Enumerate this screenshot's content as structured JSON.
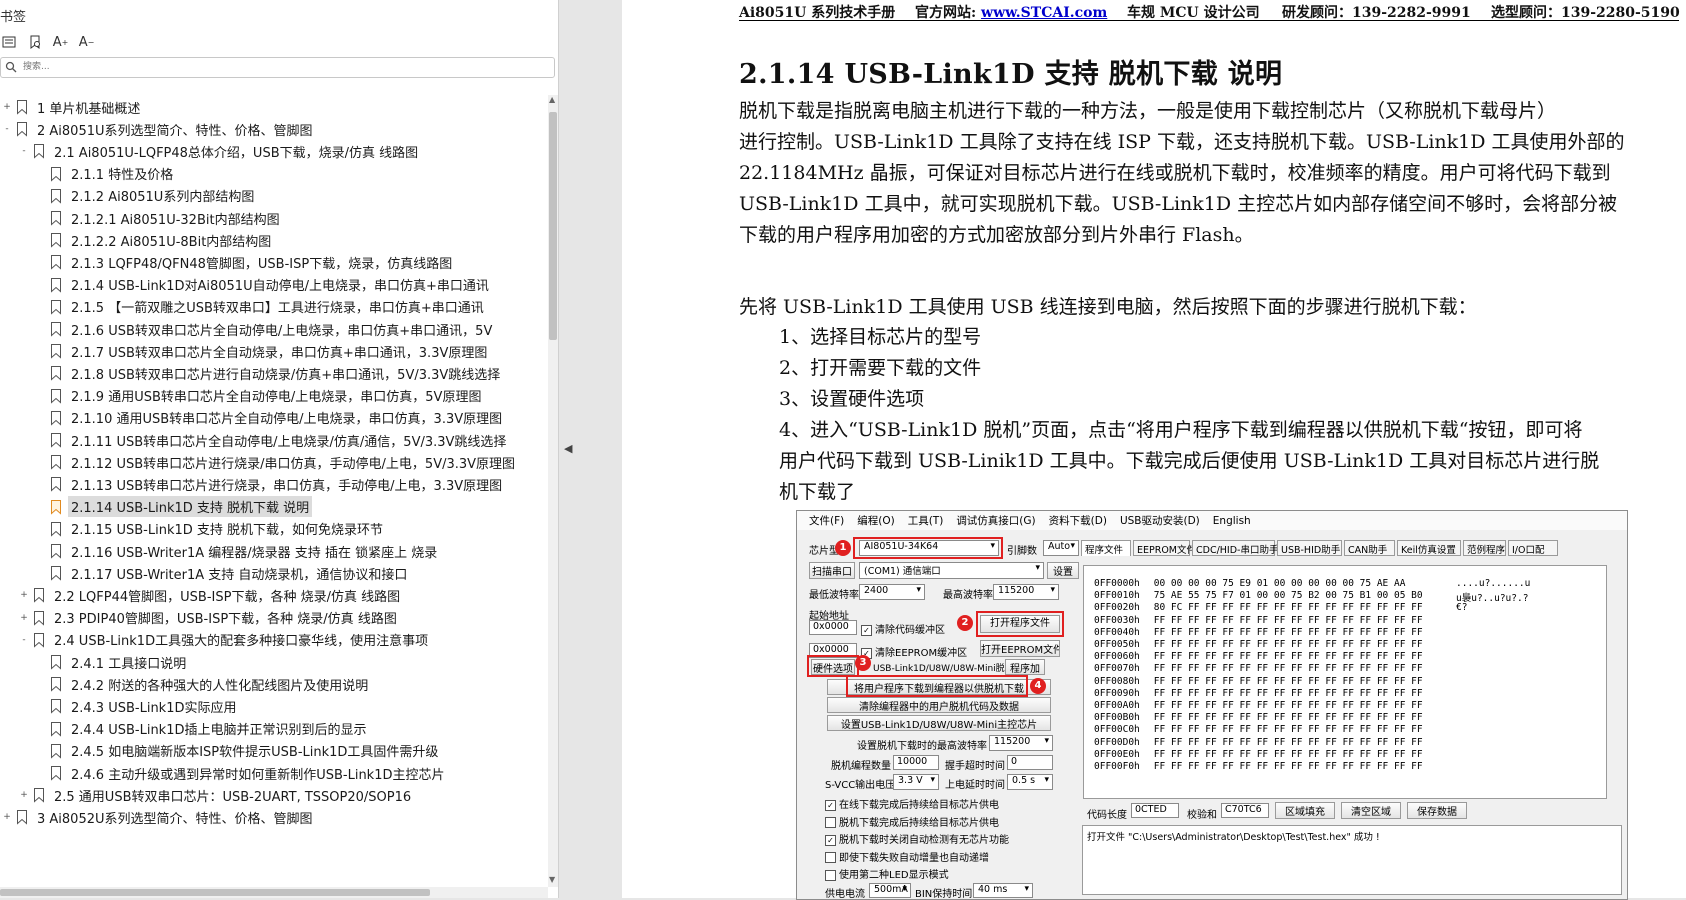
{
  "sidebar": {
    "title": "书签",
    "search_placeholder": "搜索...",
    "tree": [
      {
        "label": "1 单片机基础概述",
        "level": 0,
        "expander": "+"
      },
      {
        "label": "2  Ai8051U系列选型简介、特性、价格、管脚图",
        "level": 0,
        "expander": "-"
      },
      {
        "label": "2.1 Ai8051U-LQFP48总体介绍，USB下载，烧录/仿真 线路图",
        "level": 1,
        "expander": "-"
      },
      {
        "label": "2.1.1 特性及价格",
        "level": 2,
        "expander": ""
      },
      {
        "label": "2.1.2  Ai8051U系列内部结构图",
        "level": 2,
        "expander": ""
      },
      {
        "label": "2.1.2.1 Ai8051U-32Bit内部结构图",
        "level": 2,
        "expander": ""
      },
      {
        "label": "2.1.2.2  Ai8051U-8Bit内部结构图",
        "level": 2,
        "expander": ""
      },
      {
        "label": "2.1.3  LQFP48/QFN48管脚图，USB-ISP下载，烧录，仿真线路图",
        "level": 2,
        "expander": ""
      },
      {
        "label": "2.1.4   USB-Link1D对Ai8051U自动停电/上电烧录，串口仿真+串口通讯",
        "level": 2,
        "expander": ""
      },
      {
        "label": "2.1.5  【一箭双雕之USB转双串口】工具进行烧录，串口仿真+串口通讯",
        "level": 2,
        "expander": ""
      },
      {
        "label": "2.1.6  USB转双串口芯片全自动停电/上电烧录，串口仿真+串口通讯，5V",
        "level": 2,
        "expander": ""
      },
      {
        "label": "2.1.7  USB转双串口芯片全自动烧录，串口仿真+串口通讯，3.3V原理图",
        "level": 2,
        "expander": ""
      },
      {
        "label": "2.1.8  USB转双串口芯片进行自动烧录/仿真+串口通讯，5V/3.3V跳线选择",
        "level": 2,
        "expander": ""
      },
      {
        "label": "2.1.9  通用USB转串口芯片全自动停电/上电烧录，串口仿真，5V原理图",
        "level": 2,
        "expander": ""
      },
      {
        "label": "2.1.10  通用USB转串口芯片全自动停电/上电烧录，串口仿真，3.3V原理图",
        "level": 2,
        "expander": ""
      },
      {
        "label": "2.1.11  USB转串口芯片全自动停电/上电烧录/仿真/通信，5V/3.3V跳线选择",
        "level": 2,
        "expander": ""
      },
      {
        "label": "2.1.12  USB转串口芯片进行烧录/串口仿真，手动停电/上电，5V/3.3V原理图",
        "level": 2,
        "expander": ""
      },
      {
        "label": "2.1.13  USB转串口芯片进行烧录，串口仿真，手动停电/上电，3.3V原理图",
        "level": 2,
        "expander": ""
      },
      {
        "label": "2.1.14  USB-Link1D 支持 脱机下载 说明",
        "level": 2,
        "expander": "",
        "selected": true
      },
      {
        "label": "2.1.15  USB-Link1D 支持 脱机下载，如何免烧录环节",
        "level": 2,
        "expander": ""
      },
      {
        "label": "2.1.16  USB-Writer1A 编程器/烧录器 支持 插在 锁紧座上 烧录",
        "level": 2,
        "expander": ""
      },
      {
        "label": "2.1.17  USB-Writer1A 支持 自动烧录机，通信协议和接口",
        "level": 2,
        "expander": ""
      },
      {
        "label": "2.2  LQFP44管脚图，USB-ISP下载，各种 烧录/仿真 线路图",
        "level": 1,
        "expander": "+"
      },
      {
        "label": "2.3 PDIP40管脚图，USB-ISP下载，各种 烧录/仿真 线路图",
        "level": 1,
        "expander": "+"
      },
      {
        "label": "2.4  USB-Link1D工具强大的配套多种接口豪华线，使用注意事项",
        "level": 1,
        "expander": "-"
      },
      {
        "label": "2.4.1 工具接口说明",
        "level": 2,
        "expander": ""
      },
      {
        "label": "2.4.2  附送的各种强大的人性化配线图片及使用说明",
        "level": 2,
        "expander": ""
      },
      {
        "label": "2.4.3  USB-Link1D实际应用",
        "level": 2,
        "expander": ""
      },
      {
        "label": "2.4.4  USB-Link1D插上电脑并正常识别到后的显示",
        "level": 2,
        "expander": ""
      },
      {
        "label": "2.4.5  如电脑端新版本ISP软件提示USB-Link1D工具固件需升级",
        "level": 2,
        "expander": ""
      },
      {
        "label": "2.4.6  主动升级或遇到异常时如何重新制作USB-Link1D主控芯片",
        "level": 2,
        "expander": ""
      },
      {
        "label": "2.5  通用USB转双串口芯片：USB-2UART, TSSOP20/SOP16",
        "level": 1,
        "expander": "+"
      },
      {
        "label": "3  Ai8052U系列选型简介、特性、价格、管脚图",
        "level": 0,
        "expander": "+"
      }
    ]
  },
  "document": {
    "header": {
      "manual": "Ai8051U 系列技术手册",
      "site_label": "官方网站: ",
      "site_url": "www.STCAI.com",
      "company": "车规 MCU 设计公司",
      "advisor1": "研发顾问：139-2282-9991",
      "advisor2": "选型顾问：139-2280-5190"
    },
    "heading": "2.1.14    USB-Link1D  支持  脱机下载  说明",
    "para1": [
      "       脱机下载是指脱离电脑主机进行下载的一种方法，一般是使用下载控制芯片（又称脱机下载母片）",
      "进行控制。USB-Link1D 工具除了支持在线 ISP 下载，还支持脱机下载。USB-Link1D 工具使用外部的",
      "22.1184MHz 晶振，可保证对目标芯片进行在线或脱机下载时，校准频率的精度。用户可将代码下载到",
      "USB-Link1D 工具中，就可实现脱机下载。USB-Link1D 主控芯片如内部存储空间不够时，会将部分被",
      "下载的用户程序用加密的方式加密放部分到片外串行  Flash。"
    ],
    "para2": "先将 USB-Link1D 工具使用 USB 线连接到电脑，然后按照下面的步骤进行脱机下载：",
    "steps": [
      "1、选择目标芯片的型号",
      "2、打开需要下载的文件",
      "3、设置硬件选项",
      "4、进入“USB-Link1D 脱机”页面，点击“将用户程序下载到编程器以供脱机下载“按钮，即可将",
      "      用户代码下载到 USB-Linik1D 工具中。下载完成后便使用 USB-Link1D 工具对目标芯片进行脱",
      "      机下载了"
    ]
  },
  "isp": {
    "menu": [
      "文件(F)",
      "编程(O)",
      "工具(T)",
      "调试仿真接口(G)",
      "资料下载(D)",
      "USB驱动安装(D)",
      "English"
    ],
    "chip_label": "芯片型号",
    "chip_value": "AI8051U-34K64",
    "pin_label": "引脚数",
    "pin_value": "Auto",
    "scan_port": "扫描串口",
    "port_value": "(COM1) 通信端口",
    "settings": "设置",
    "min_baud_label": "最低波特率",
    "min_baud": "2400",
    "max_baud_label": "最高波特率",
    "max_baud": "115200",
    "start_addr_label": "起始地址",
    "addr1": "0x0000",
    "addr2": "0x0000",
    "clear_code": "清除代码缓冲区",
    "clear_eeprom": "清除EEPROM缓冲区",
    "open_prog": "打开程序文件",
    "open_eeprom": "打开EEPROM文件",
    "hw_options": "硬件选项",
    "offline_tab": "USB-Link1D/U8W/U8W-Mini脱机",
    "prog_tab": "程序加",
    "btn_download": "将用户程序下载到编程器以供脱机下载",
    "btn_clear": "清除编程器中的用户脱机代码及数据",
    "btn_set": "设置USB-Link1D/U8W/U8W-Mini主控芯片",
    "max_rate_label": "设置脱机下载时的最高波特率",
    "max_rate": "115200",
    "offline_count_label": "脱机编程数量",
    "offline_count": "10000",
    "handshake_label": "握手超时时间",
    "handshake": "0",
    "svcc_label": "S-VCC输出电压",
    "svcc": "3.3 V",
    "poweron_label": "上电延时时间",
    "poweron": "0.5 s",
    "options": [
      {
        "label": "在线下载完成后持续给目标芯片供电",
        "checked": true
      },
      {
        "label": "脱机下载完成后持续给目标芯片供电",
        "checked": false
      },
      {
        "label": "脱机下载时关闭自动检测有无芯片功能",
        "checked": true
      },
      {
        "label": "即使下载失败自动增量也自动递增",
        "checked": false
      },
      {
        "label": "使用第二种LED显示模式",
        "checked": false
      }
    ],
    "supply_label": "供电电流",
    "supply": "500mA",
    "bin_label": "BIN保持时间",
    "bin": "40 ms",
    "right_tabs": [
      "程序文件",
      "EEPROM文件",
      "CDC/HID-串口助手",
      "USB-HID助手",
      "CAN助手",
      "Keil仿真设置",
      "范例程序",
      "I/O口配"
    ],
    "hex_rows": [
      {
        "addr": "0FF0000h",
        "bytes": "00 00 00 00 75 E9 01 00 00 00 00 00 75 AE AA",
        "ascii": "....u?......u"
      },
      {
        "addr": "0FF0010h",
        "bytes": "75 AE 55 75 F7 01 00 00 75 B2 00 75 B1 00 05 B0",
        "ascii": "u裊u?..u?u?.?"
      },
      {
        "addr": "0FF0020h",
        "bytes": "80 FC FF FF FF FF FF FF FF FF FF FF FF FF FF FF",
        "ascii": "€?"
      },
      {
        "addr": "0FF0030h",
        "bytes": "FF FF FF FF FF FF FF FF FF FF FF FF FF FF FF FF",
        "ascii": ""
      },
      {
        "addr": "0FF0040h",
        "bytes": "FF FF FF FF FF FF FF FF FF FF FF FF FF FF FF FF",
        "ascii": ""
      },
      {
        "addr": "0FF0050h",
        "bytes": "FF FF FF FF FF FF FF FF FF FF FF FF FF FF FF FF",
        "ascii": ""
      },
      {
        "addr": "0FF0060h",
        "bytes": "FF FF FF FF FF FF FF FF FF FF FF FF FF FF FF FF",
        "ascii": ""
      },
      {
        "addr": "0FF0070h",
        "bytes": "FF FF FF FF FF FF FF FF FF FF FF FF FF FF FF FF",
        "ascii": ""
      },
      {
        "addr": "0FF0080h",
        "bytes": "FF FF FF FF FF FF FF FF FF FF FF FF FF FF FF FF",
        "ascii": ""
      },
      {
        "addr": "0FF0090h",
        "bytes": "FF FF FF FF FF FF FF FF FF FF FF FF FF FF FF FF",
        "ascii": ""
      },
      {
        "addr": "0FF00A0h",
        "bytes": "FF FF FF FF FF FF FF FF FF FF FF FF FF FF FF FF",
        "ascii": ""
      },
      {
        "addr": "0FF00B0h",
        "bytes": "FF FF FF FF FF FF FF FF FF FF FF FF FF FF FF FF",
        "ascii": ""
      },
      {
        "addr": "0FF00C0h",
        "bytes": "FF FF FF FF FF FF FF FF FF FF FF FF FF FF FF FF",
        "ascii": ""
      },
      {
        "addr": "0FF00D0h",
        "bytes": "FF FF FF FF FF FF FF FF FF FF FF FF FF FF FF FF",
        "ascii": ""
      },
      {
        "addr": "0FF00E0h",
        "bytes": "FF FF FF FF FF FF FF FF FF FF FF FF FF FF FF FF",
        "ascii": ""
      },
      {
        "addr": "0FF00F0h",
        "bytes": "FF FF FF FF FF FF FF FF FF FF FF FF FF FF FF FF",
        "ascii": ""
      }
    ],
    "code_len_label": "代码长度",
    "code_len": "0CTED",
    "checksum_label": "校验和",
    "checksum": "C70TC6",
    "fill_btn": "区域填充",
    "clear_btn": "清空区域",
    "save_btn": "保存数据",
    "log": "打开文件 \"C:\\Users\\Administrator\\Desktop\\Test\\Test.hex\" 成功 !",
    "badges": [
      "1",
      "2",
      "3",
      "4"
    ]
  },
  "colors": {
    "highlight": "#e02020",
    "link": "#0000cc",
    "selected_row": "#dcdcdc"
  }
}
